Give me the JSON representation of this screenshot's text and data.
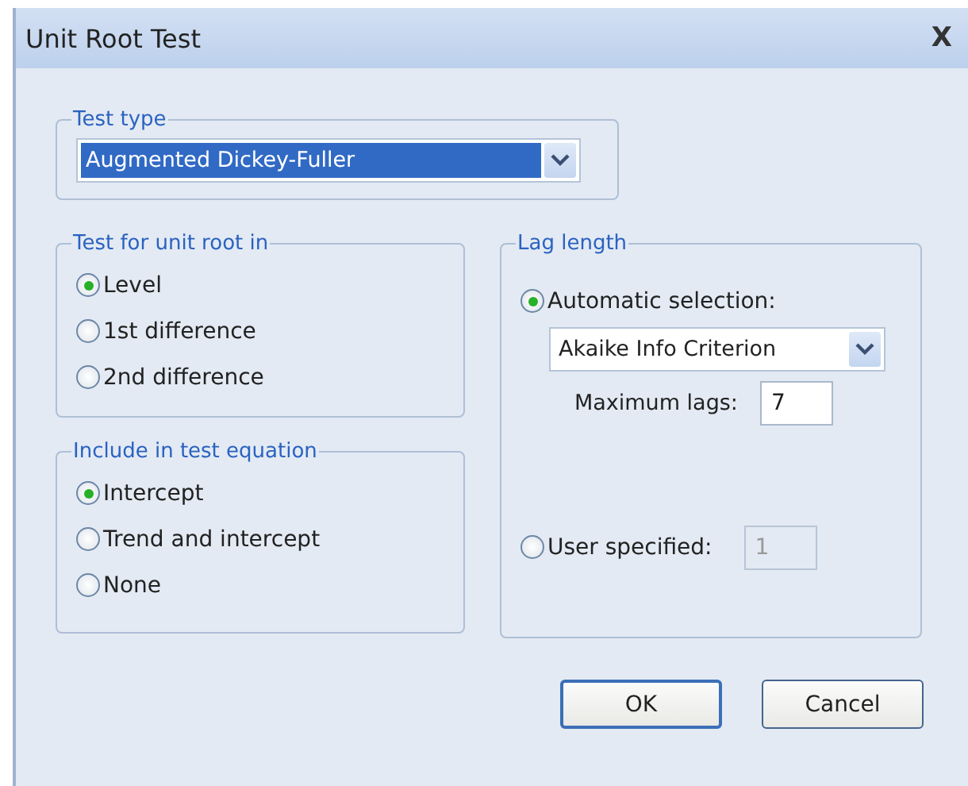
{
  "window": {
    "title": "Unit Root Test",
    "close": "X"
  },
  "test_type": {
    "legend": "Test type",
    "value": "Augmented Dickey-Fuller",
    "highlighted": true
  },
  "unit_root_in": {
    "legend": "Test for unit root in",
    "options": [
      {
        "label": "Level",
        "selected": true
      },
      {
        "label": "1st difference",
        "selected": false
      },
      {
        "label": "2nd difference",
        "selected": false
      }
    ]
  },
  "include_in_equation": {
    "legend": "Include in test equation",
    "options": [
      {
        "label": "Intercept",
        "selected": true
      },
      {
        "label": "Trend and intercept",
        "selected": false
      },
      {
        "label": "None",
        "selected": false
      }
    ]
  },
  "lag_length": {
    "legend": "Lag length",
    "automatic": {
      "label": "Automatic selection:",
      "selected": true
    },
    "criterion": "Akaike Info Criterion",
    "max_lags": {
      "label": "Maximum lags:",
      "value": "7"
    },
    "user_specified": {
      "label": "User specified:",
      "selected": false,
      "value": "1",
      "disabled": true
    }
  },
  "buttons": [
    {
      "label": "OK",
      "default": true
    },
    {
      "label": "Cancel",
      "default": false
    }
  ]
}
